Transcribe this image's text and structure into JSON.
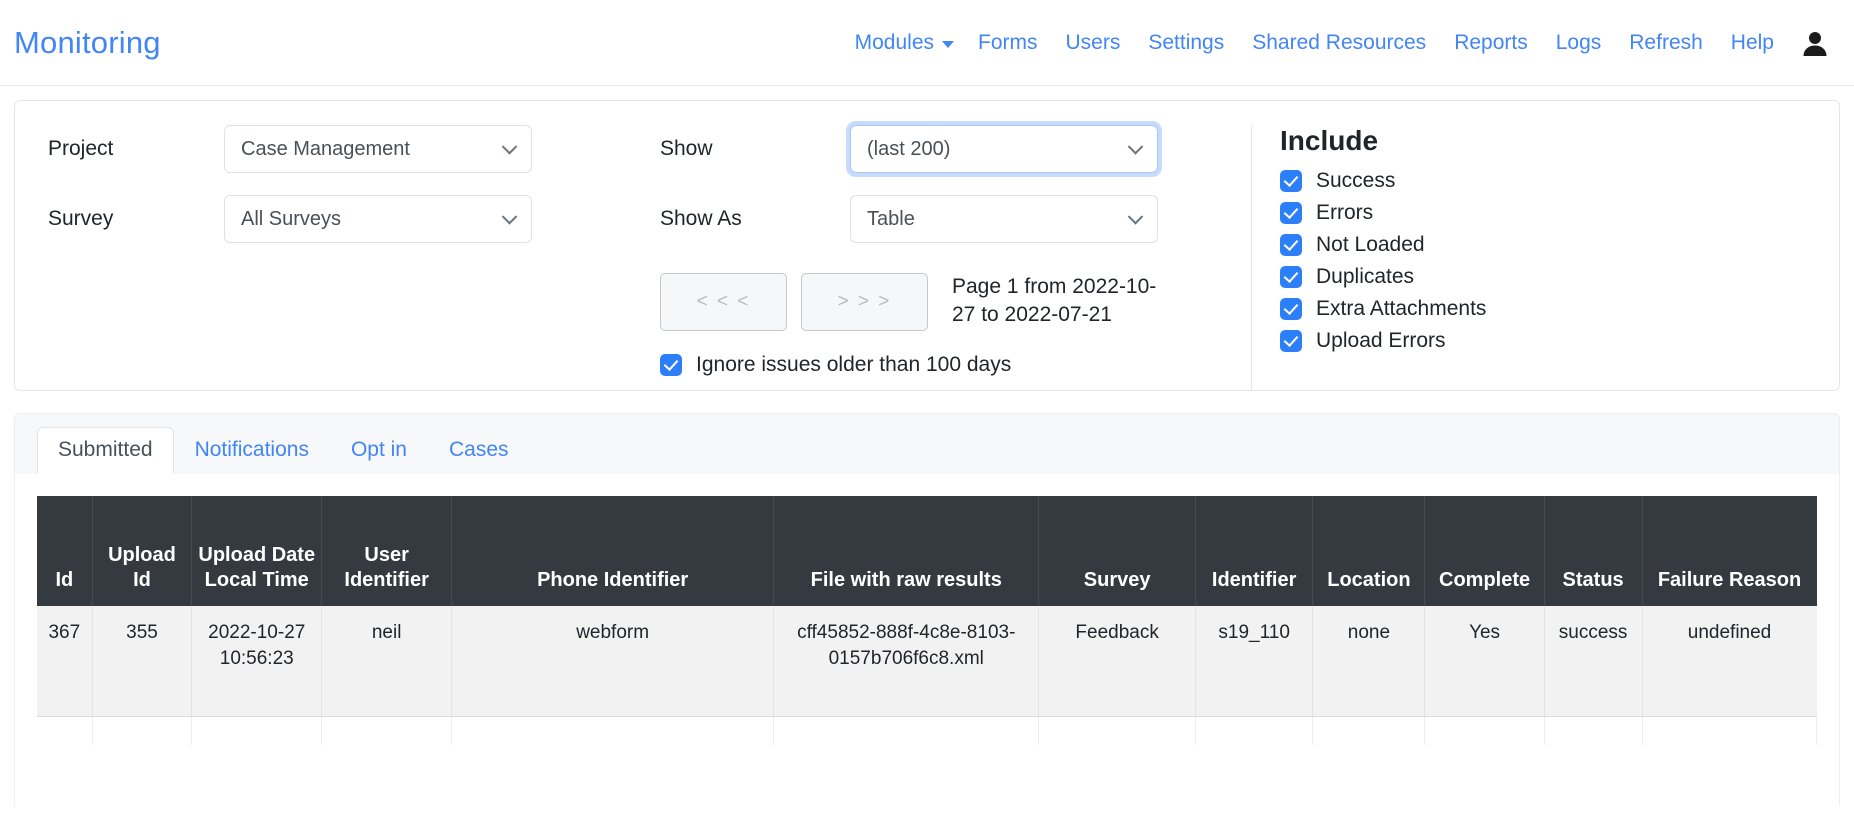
{
  "navbar": {
    "brand": "Monitoring",
    "links": [
      {
        "label": "Modules",
        "caret": true
      },
      {
        "label": "Forms",
        "caret": false
      },
      {
        "label": "Users",
        "caret": false
      },
      {
        "label": "Settings",
        "caret": false
      },
      {
        "label": "Shared Resources",
        "caret": false
      },
      {
        "label": "Reports",
        "caret": false
      },
      {
        "label": "Logs",
        "caret": false
      },
      {
        "label": "Refresh",
        "caret": false
      },
      {
        "label": "Help",
        "caret": false
      }
    ],
    "user_icon": "user-icon"
  },
  "filters": {
    "project_label": "Project",
    "project_value": "Case Management",
    "survey_label": "Survey",
    "survey_value": "All Surveys",
    "show_label": "Show",
    "show_value": "(last 200)",
    "show_as_label": "Show As",
    "show_as_value": "Table",
    "prev_label": "< < <",
    "next_label": "> > >",
    "page_info": "Page 1 from 2022-10-27 to 2022-07-21",
    "ignore_label": "Ignore issues older than 100 days",
    "ignore_checked": true
  },
  "include": {
    "title": "Include",
    "items": [
      {
        "label": "Success",
        "checked": true
      },
      {
        "label": "Errors",
        "checked": true
      },
      {
        "label": "Not Loaded",
        "checked": true
      },
      {
        "label": "Duplicates",
        "checked": true
      },
      {
        "label": "Extra Attachments",
        "checked": true
      },
      {
        "label": "Upload Errors",
        "checked": true
      }
    ]
  },
  "tabs": [
    {
      "label": "Submitted",
      "active": true
    },
    {
      "label": "Notifications",
      "active": false
    },
    {
      "label": "Opt in",
      "active": false
    },
    {
      "label": "Cases",
      "active": false
    }
  ],
  "table": {
    "columns": [
      "Id",
      "Upload Id",
      "Upload Date Local Time",
      "User Identifier",
      "Phone Identifier",
      "File with raw results",
      "Survey",
      "Identifier",
      "Location",
      "Complete",
      "Status",
      "Failure Reason"
    ],
    "rows": [
      [
        "367",
        "355",
        "2022-10-27 10:56:23",
        "neil",
        "webform",
        "cff45852-888f-4c8e-8103-0157b706f6c8.xml",
        "Feedback",
        "s19_110",
        "none",
        "Yes",
        "success",
        "undefined"
      ]
    ]
  },
  "colors": {
    "link": "#4285f4",
    "accent": "#2d7ff9",
    "table_header_bg": "#343a40",
    "row_bg": "#f2f2f2"
  }
}
